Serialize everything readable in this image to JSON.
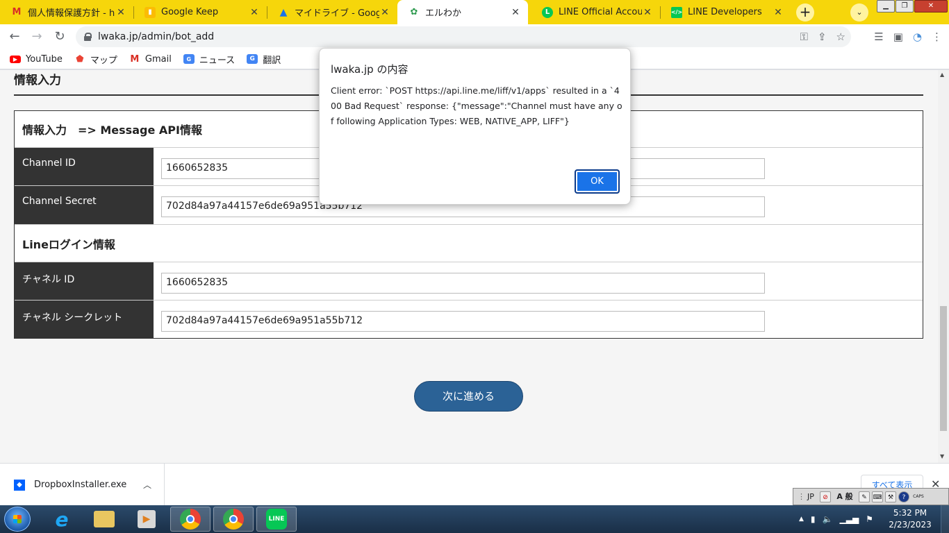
{
  "browser": {
    "tabs": [
      {
        "title": "個人情報保護方針 - ho",
        "icon": "gmail-icon",
        "active": false
      },
      {
        "title": "Google Keep",
        "icon": "keep-icon",
        "active": false
      },
      {
        "title": "マイドライブ - Google",
        "icon": "drive-icon",
        "active": false
      },
      {
        "title": "エルわか",
        "icon": "site-icon",
        "active": true
      },
      {
        "title": "LINE Official Account",
        "icon": "line-icon",
        "active": false
      },
      {
        "title": "LINE Developers",
        "icon": "line-developers-icon",
        "active": false
      }
    ],
    "url": "lwaka.jp/admin/bot_add",
    "bookmarks": [
      {
        "label": "YouTube",
        "icon": "youtube-icon"
      },
      {
        "label": "マップ",
        "icon": "maps-icon"
      },
      {
        "label": "Gmail",
        "icon": "gmail-icon"
      },
      {
        "label": "ニュース",
        "icon": "news-icon"
      },
      {
        "label": "翻訳",
        "icon": "translate-icon"
      }
    ],
    "accent_color": "#f6d60b"
  },
  "page": {
    "section_heading": "情報入力",
    "group_api": "情報入力　=> Message API情報",
    "channel_id_label": "Channel ID",
    "channel_id_value": "1660652835",
    "channel_secret_label": "Channel Secret",
    "channel_secret_value": "702d84a97a44157e6de69a951a55b712",
    "group_login": "Lineログイン情報",
    "login_channel_id_label": "チャネル ID",
    "login_channel_id_value": "1660652835",
    "login_channel_secret_label": "チャネル シークレット",
    "login_channel_secret_value": "702d84a97a44157e6de69a951a55b712",
    "next_button": "次に進める"
  },
  "dialog": {
    "title": "lwaka.jp の内容",
    "message": "Client error: `POST https://api.line.me/liff/v1/apps` resulted in a `400 Bad Request` response: {\"message\":\"Channel must have any of following Application Types: WEB, NATIVE_APP, LIFF\"}",
    "ok_label": "OK"
  },
  "downloads": {
    "file_name": "DropboxInstaller.exe",
    "show_all": "すべて表示"
  },
  "ime": {
    "lang": "JP",
    "mode": "A 般"
  },
  "taskbar": {
    "time": "5:32 PM",
    "date": "2/23/2023"
  }
}
